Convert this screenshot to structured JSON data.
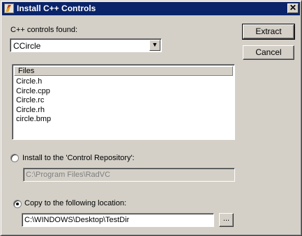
{
  "window": {
    "title": "Install C++ Controls",
    "close_glyph": "✕"
  },
  "controls_found": {
    "label": "C++ controls found:",
    "selected": "CCircle"
  },
  "buttons": {
    "extract": "Extract",
    "cancel": "Cancel",
    "browse": "..."
  },
  "files": {
    "header": "Files",
    "items": [
      "Circle.h",
      "Circle.cpp",
      "Circle.rc",
      "Circle.rh",
      "circle.bmp"
    ]
  },
  "install_option": {
    "label": "Install to the 'Control Repository':",
    "path": "C:\\Program Files\\RadVC",
    "selected": false
  },
  "copy_option": {
    "label": "Copy to the following location:",
    "path": "C:\\WINDOWS\\Desktop\\TestDir",
    "selected": true
  },
  "icons": {
    "app": "app-icon",
    "close": "close-icon",
    "dropdown": "chevron-down-icon"
  },
  "colors": {
    "titlebar": "#0a246a",
    "face": "#d4d0c8"
  }
}
